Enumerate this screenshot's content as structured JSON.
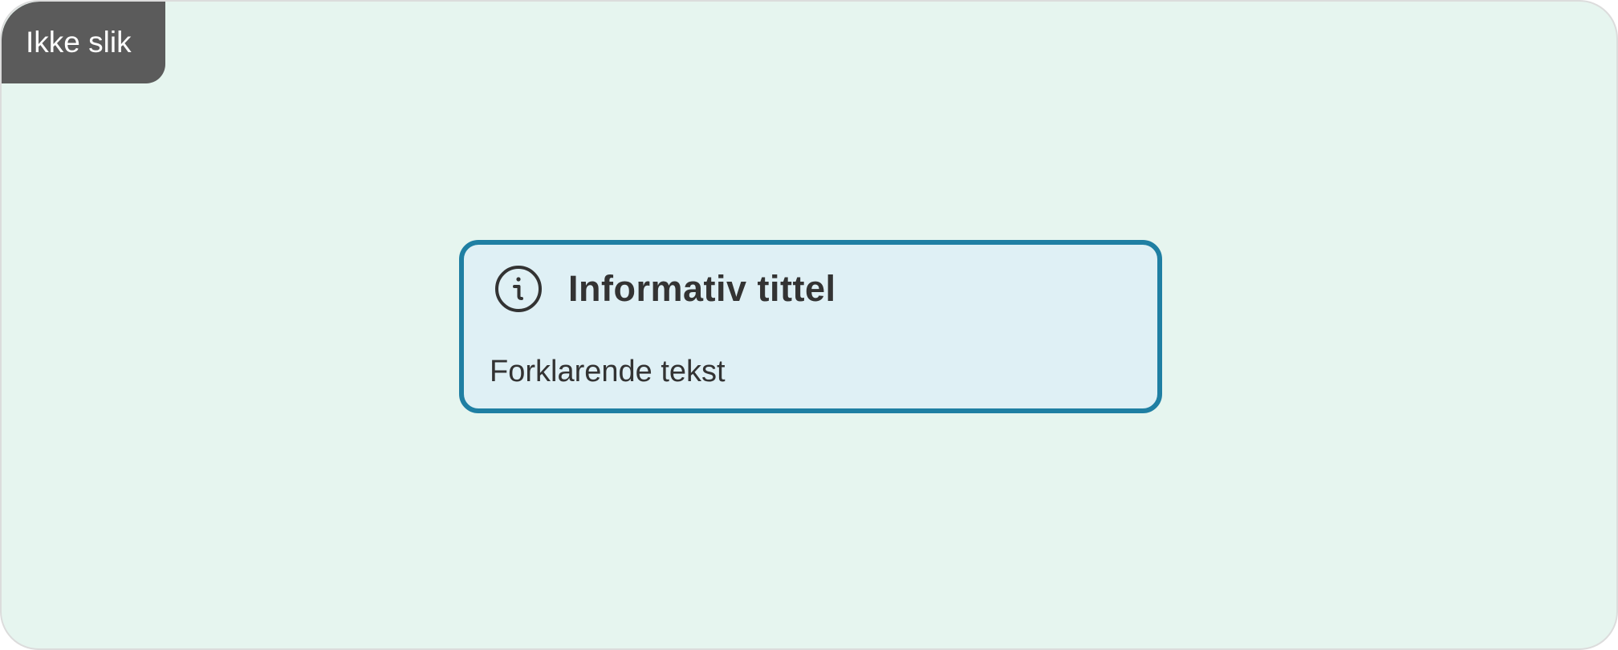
{
  "badge": {
    "label": "Ikke slik"
  },
  "alert": {
    "icon": "info-circle-icon",
    "title": "Informativ tittel",
    "text": "Forklarende tekst"
  },
  "colors": {
    "background": "#e6f5ef",
    "badge": "#5b5b5b",
    "alert_border": "#1f7fa3",
    "alert_fill": "#dff0f5",
    "text": "#333333"
  }
}
